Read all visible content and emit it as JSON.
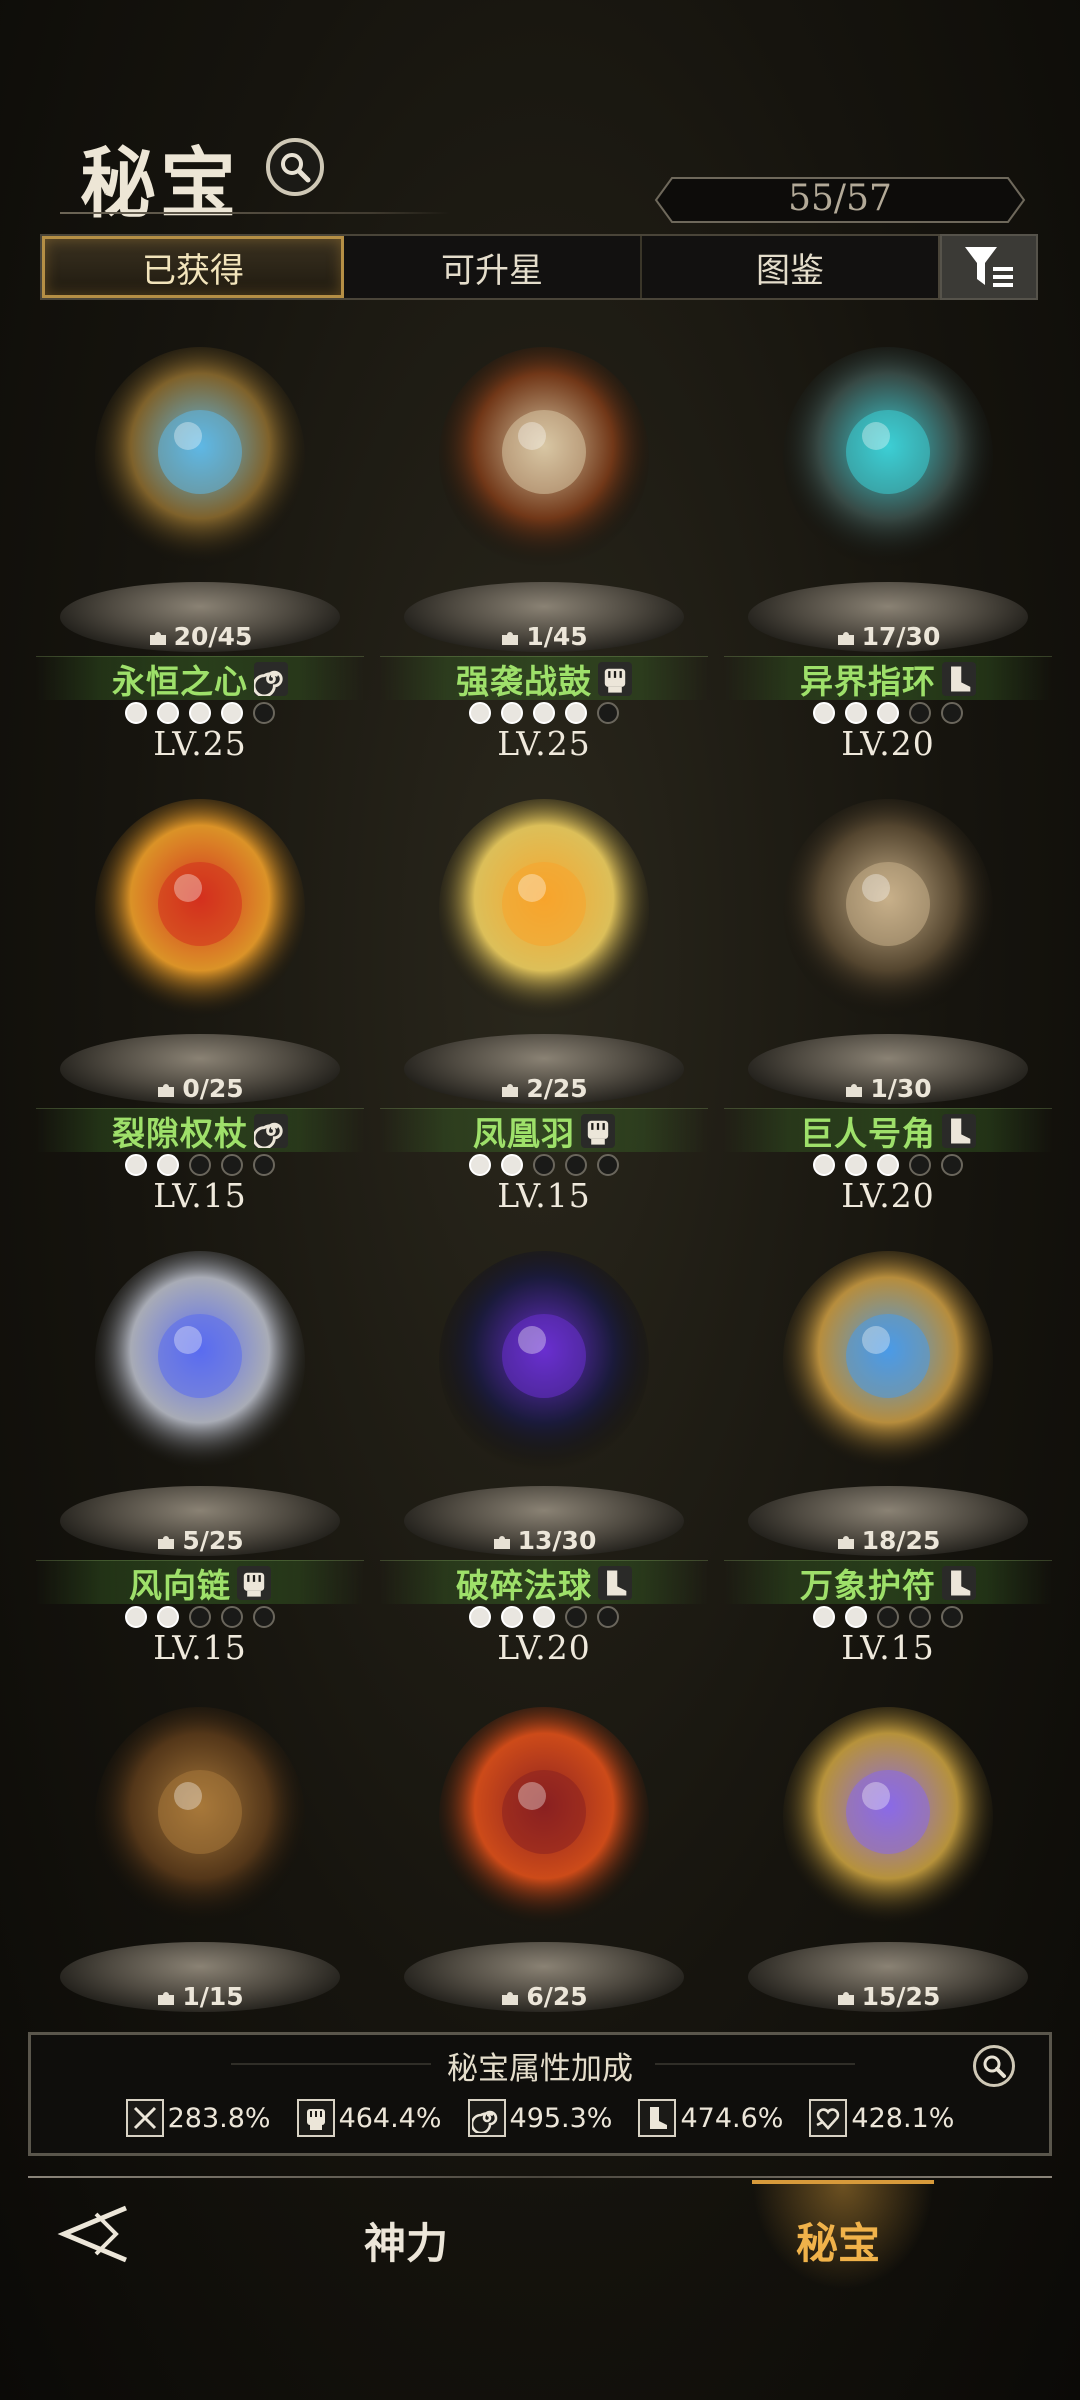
{
  "header": {
    "title": "秘宝",
    "counter": "55/57"
  },
  "tabs": [
    {
      "label": "已获得",
      "active": true
    },
    {
      "label": "可升星",
      "active": false
    },
    {
      "label": "图鉴",
      "active": false
    }
  ],
  "items": [
    {
      "name": "永恒之心",
      "shards": "20/45",
      "stars": 4,
      "max_stars": 5,
      "level": "LV.25",
      "type_icon": "spiral-icon"
    },
    {
      "name": "强袭战鼓",
      "shards": "1/45",
      "stars": 4,
      "max_stars": 5,
      "level": "LV.25",
      "type_icon": "fist-icon"
    },
    {
      "name": "异界指环",
      "shards": "17/30",
      "stars": 3,
      "max_stars": 5,
      "level": "LV.20",
      "type_icon": "boot-icon"
    },
    {
      "name": "裂隙权杖",
      "shards": "0/25",
      "stars": 2,
      "max_stars": 5,
      "level": "LV.15",
      "type_icon": "spiral-icon"
    },
    {
      "name": "凤凰羽",
      "shards": "2/25",
      "stars": 2,
      "max_stars": 5,
      "level": "LV.15",
      "type_icon": "fist-icon"
    },
    {
      "name": "巨人号角",
      "shards": "1/30",
      "stars": 3,
      "max_stars": 5,
      "level": "LV.20",
      "type_icon": "boot-icon"
    },
    {
      "name": "风向链",
      "shards": "5/25",
      "stars": 2,
      "max_stars": 5,
      "level": "LV.15",
      "type_icon": "fist-icon"
    },
    {
      "name": "破碎法球",
      "shards": "13/30",
      "stars": 3,
      "max_stars": 5,
      "level": "LV.20",
      "type_icon": "boot-icon"
    },
    {
      "name": "万象护符",
      "shards": "18/25",
      "stars": 2,
      "max_stars": 5,
      "level": "LV.15",
      "type_icon": "boot-icon"
    },
    {
      "name": "",
      "shards": "1/15",
      "stars": null,
      "max_stars": null,
      "level": "",
      "type_icon": ""
    },
    {
      "name": "",
      "shards": "6/25",
      "stars": null,
      "max_stars": null,
      "level": "",
      "type_icon": ""
    },
    {
      "name": "",
      "shards": "15/25",
      "stars": null,
      "max_stars": null,
      "level": "",
      "type_icon": ""
    }
  ],
  "bonus": {
    "title": "秘宝属性加成",
    "stats": [
      {
        "icon": "sword-icon",
        "value": "283.8%"
      },
      {
        "icon": "fist-icon",
        "value": "464.4%"
      },
      {
        "icon": "spiral-icon",
        "value": "495.3%"
      },
      {
        "icon": "boot-icon",
        "value": "474.6%"
      },
      {
        "icon": "heart-hand-icon",
        "value": "428.1%"
      }
    ]
  },
  "nav": {
    "godpower": "神力",
    "secret": "秘宝"
  },
  "colors": {
    "accent_gold": "#f0b24a",
    "item_name_green": "#9ee06a"
  }
}
